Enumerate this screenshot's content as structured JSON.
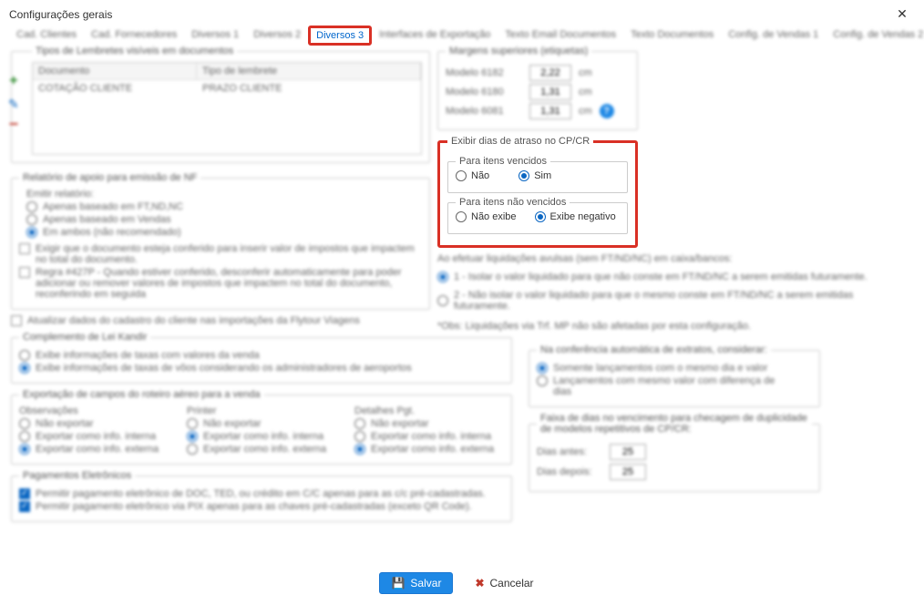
{
  "window": {
    "title": "Configurações gerais"
  },
  "tabs": [
    "Cad. Clientes",
    "Cad. Fornecedores",
    "Diversos 1",
    "Diversos 2",
    "Diversos 3",
    "Interfaces de Exportação",
    "Texto Email Documentos",
    "Texto Documentos",
    "Config. de Vendas 1",
    "Config. de Vendas 2"
  ],
  "lembretes": {
    "legend": "Tipos de Lembretes visíveis em documentos",
    "headers": {
      "doc": "Documento",
      "tipo": "Tipo de lembrete"
    },
    "rows": [
      {
        "doc": "COTAÇÃO CLIENTE",
        "tipo": "PRAZO CLIENTE"
      }
    ]
  },
  "relatorio_nf": {
    "legend": "Relatório de apoio para emissão de NF",
    "emitir_label": "Emitir relatório:",
    "opts": [
      "Apenas baseado em FT,ND,NC",
      "Apenas baseado em Vendas",
      "Em ambos (não recomendado)"
    ],
    "chk1": "Exigir que o documento esteja conferido para inserir valor de impostos que impactem no total do documento.",
    "chk2": "Regra #427P - Quando estiver conferido, desconferir automaticamente para poder adicionar ou remover valores de impostos que impactem no total do documento, reconferindo em seguida"
  },
  "chk_flytour": "Atualizar dados do cadastro do cliente nas importações da Flytour Viagens",
  "lei_kandir": {
    "legend": "Complemento de Lei Kandir",
    "opts": [
      "Exibe informações de taxas com valores da venda",
      "Exibe informações de taxas de vôos considerando os administradores de aeroportos"
    ]
  },
  "export_roteiro": {
    "legend": "Exportação de campos do roteiro aéreo para a venda",
    "cols": [
      "Observações",
      "Printer",
      "Detalhes Pgt."
    ],
    "opts": [
      "Não exportar",
      "Exportar como info. interna",
      "Exportar como info. externa"
    ]
  },
  "pagamentos": {
    "legend": "Pagamentos Eletrônicos",
    "chk1": "Permitir pagamento eletrônico de DOC, TED, ou crédito em C/C apenas para as c/c pré-cadastradas.",
    "chk2": "Permitir pagamento eletrônico via PIX apenas para as chaves pré-cadastradas (exceto QR Code)."
  },
  "margens": {
    "legend": "Margens superiores (etiquetas)",
    "rows": [
      {
        "label": "Modelo 6182",
        "val": "2,22",
        "unit": "cm"
      },
      {
        "label": "Modelo 6180",
        "val": "1,31",
        "unit": "cm"
      },
      {
        "label": "Modelo 6081",
        "val": "1,31",
        "unit": "cm",
        "help": true
      }
    ]
  },
  "atraso": {
    "legend": "Exibir dias de atraso no CP/CR",
    "sub1": "Para itens vencidos",
    "opt1a": "Não",
    "opt1b": "Sim",
    "sub2": "Para itens não vencidos",
    "opt2a": "Não exibe",
    "opt2b": "Exibe negativo"
  },
  "liquidacoes": {
    "legend": "Ao efetuar liquidações avulsas (sem FT/ND/NC) em caixa/bancos:",
    "opt1": "1 - Isolar o valor liquidado para que não conste em FT/ND/NC a serem emitidas futuramente.",
    "opt2": "2 - Não isolar o valor liquidado para que o mesmo conste em FT/ND/NC a serem emitidas futuramente.",
    "note": "*Obs: Liquidações via Trf. MP não são afetadas por esta configuração."
  },
  "conferencia": {
    "legend": "Na conferência automática de extratos, considerar:",
    "opt1": "Somente lançamentos com o mesmo dia e valor",
    "opt2": "Lançamentos com mesmo valor com diferença de                  dias"
  },
  "faixa": {
    "legend": "Faixa de dias no vencimento para checagem de duplicidade de modelos repetitivos de CP/CR:",
    "before_label": "Dias antes:",
    "before_val": "25",
    "after_label": "Dias depois:",
    "after_val": "25"
  },
  "buttons": {
    "save": "Salvar",
    "cancel": "Cancelar"
  }
}
